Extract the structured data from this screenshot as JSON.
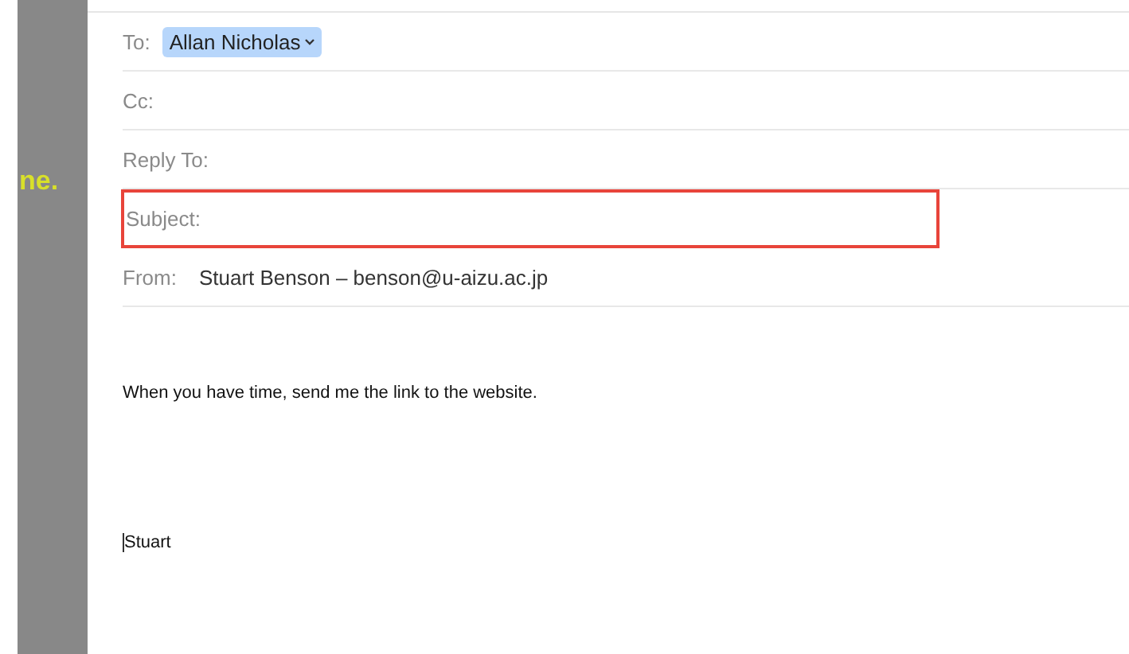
{
  "side_strip": {
    "text": "ne."
  },
  "header_fields": [
    {
      "kind": "recipients",
      "label": "To:",
      "recipients": [
        {
          "name": "Allan Nicholas",
          "selected": true
        }
      ]
    },
    {
      "kind": "empty",
      "label": "Cc:"
    },
    {
      "kind": "empty",
      "label": "Reply To:"
    },
    {
      "kind": "empty",
      "label": "Subject:",
      "highlighted": true
    },
    {
      "kind": "sender",
      "label": "From:",
      "value": "Stuart Benson – benson@u-aizu.ac.jp"
    }
  ],
  "body": {
    "paragraphs": [
      "When you have time, send me the link to the website."
    ],
    "signature": "Stuart"
  }
}
